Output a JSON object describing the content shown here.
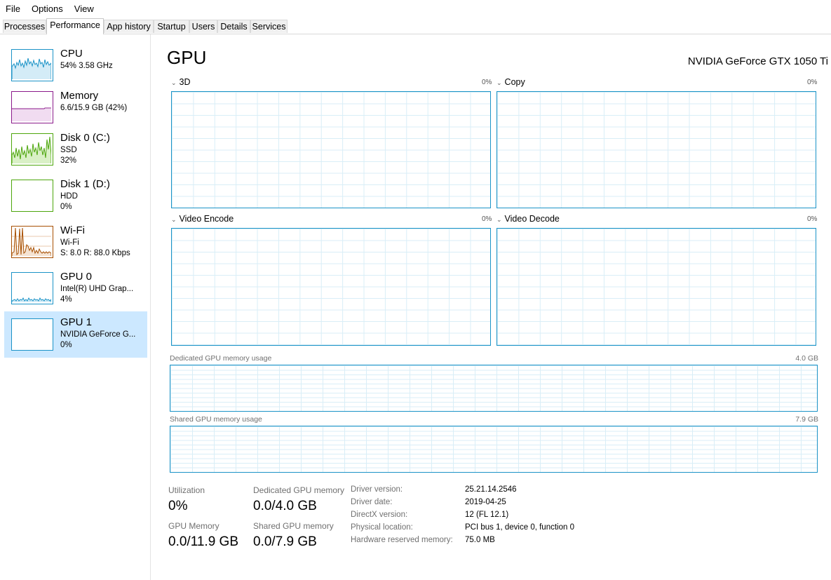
{
  "menu": [
    "File",
    "Options",
    "View"
  ],
  "tabs": [
    "Processes",
    "Performance",
    "App history",
    "Startup",
    "Users",
    "Details",
    "Services"
  ],
  "active_tab": "Performance",
  "sidebar": [
    {
      "title": "CPU",
      "sub1": "54%  3.58 GHz",
      "sub2": "",
      "sub3": "",
      "color": "#1b93c7"
    },
    {
      "title": "Memory",
      "sub1": "6.6/15.9 GB (42%)",
      "sub2": "",
      "sub3": "",
      "color": "#8b1a8b"
    },
    {
      "title": "Disk 0 (C:)",
      "sub1": "SSD",
      "sub2": "32%",
      "sub3": "",
      "color": "#4da60c"
    },
    {
      "title": "Disk 1 (D:)",
      "sub1": "HDD",
      "sub2": "0%",
      "sub3": "",
      "color": "#4da60c"
    },
    {
      "title": "Wi-Fi",
      "sub1": "Wi-Fi",
      "sub2": "S: 8.0  R: 88.0 Kbps",
      "sub3": "",
      "color": "#a74f01"
    },
    {
      "title": "GPU 0",
      "sub1": "Intel(R) UHD Grap...",
      "sub2": "4%",
      "sub3": "",
      "color": "#1b93c7"
    },
    {
      "title": "GPU 1",
      "sub1": "NVIDIA GeForce G...",
      "sub2": "0%",
      "sub3": "",
      "color": "#1b93c7",
      "selected": true
    }
  ],
  "main": {
    "title": "GPU",
    "device_name": "NVIDIA GeForce GTX 1050 Ti",
    "engines": [
      {
        "label": "3D",
        "pct": "0%"
      },
      {
        "label": "Copy",
        "pct": "0%"
      },
      {
        "label": "Video Encode",
        "pct": "0%"
      },
      {
        "label": "Video Decode",
        "pct": "0%"
      }
    ],
    "dedicated_label": "Dedicated GPU memory usage",
    "dedicated_max": "4.0 GB",
    "shared_label": "Shared GPU memory usage",
    "shared_max": "7.9 GB",
    "stats": {
      "utilization_label": "Utilization",
      "utilization_value": "0%",
      "dedicated_label": "Dedicated GPU memory",
      "dedicated_value": "0.0/4.0 GB",
      "gpu_memory_label": "GPU Memory",
      "gpu_memory_value": "0.0/11.9 GB",
      "shared_label": "Shared GPU memory",
      "shared_value": "0.0/7.9 GB"
    },
    "info": [
      {
        "key": "Driver version:",
        "value": "25.21.14.2546"
      },
      {
        "key": "Driver date:",
        "value": "2019-04-25"
      },
      {
        "key": "DirectX version:",
        "value": "12 (FL 12.1)"
      },
      {
        "key": "Physical location:",
        "value": "PCI bus 1, device 0, function 0"
      },
      {
        "key": "Hardware reserved memory:",
        "value": "75.0 MB"
      }
    ]
  },
  "accent": "#1b93c7",
  "selected_bg": "#cce8ff"
}
